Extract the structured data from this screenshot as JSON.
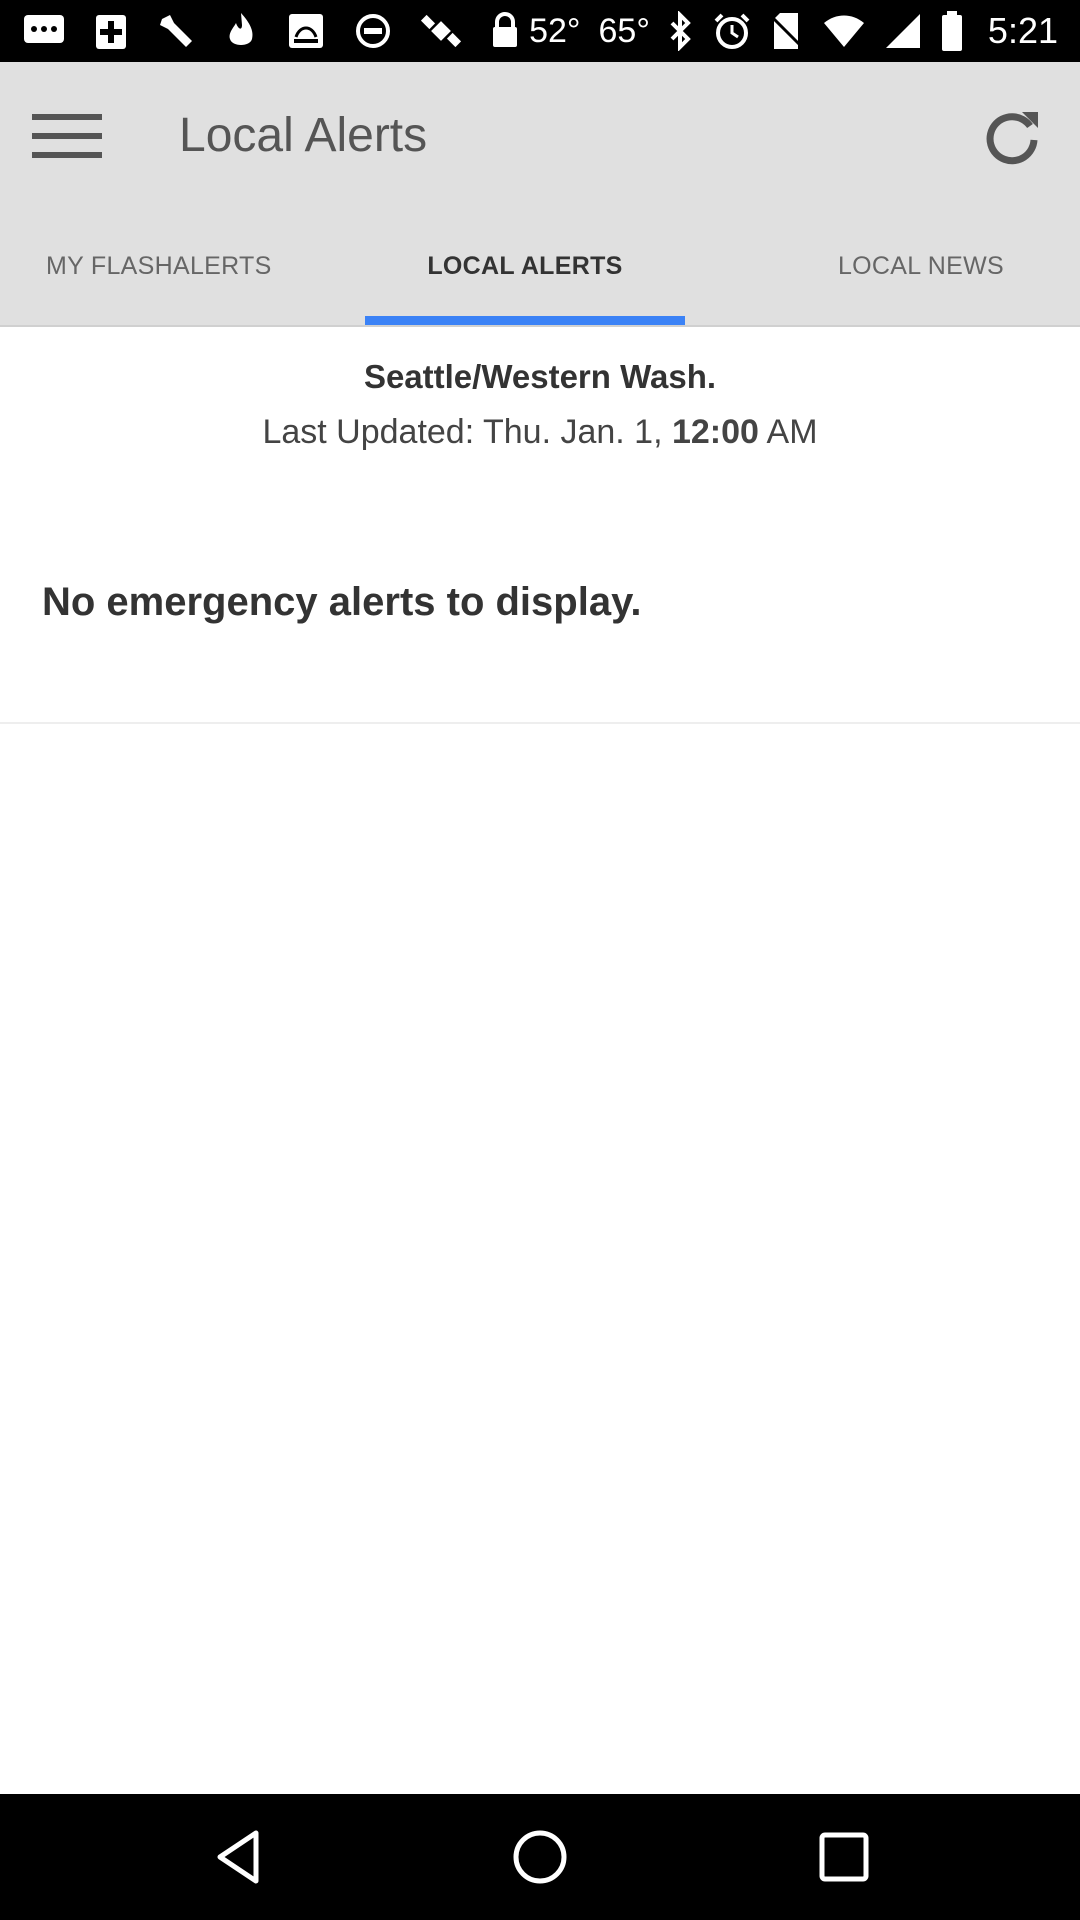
{
  "status_bar": {
    "temp_1": "52°",
    "temp_2": "65°",
    "time": "5:21"
  },
  "app_bar": {
    "title": "Local Alerts"
  },
  "tabs": [
    {
      "label": "MY FLASHALERTS",
      "active": false
    },
    {
      "label": "LOCAL ALERTS",
      "active": true
    },
    {
      "label": "LOCAL NEWS",
      "active": false
    }
  ],
  "content": {
    "region": "Seattle/Western Wash.",
    "last_updated_prefix": "Last Updated: Thu. Jan. 1, ",
    "last_updated_time": "12:00",
    "last_updated_suffix": " AM",
    "empty_message": "No emergency alerts to display."
  },
  "colors": {
    "app_bar_bg": "#e0e0e0",
    "tab_indicator": "#3b82f6",
    "status_bar_bg": "#000000"
  }
}
